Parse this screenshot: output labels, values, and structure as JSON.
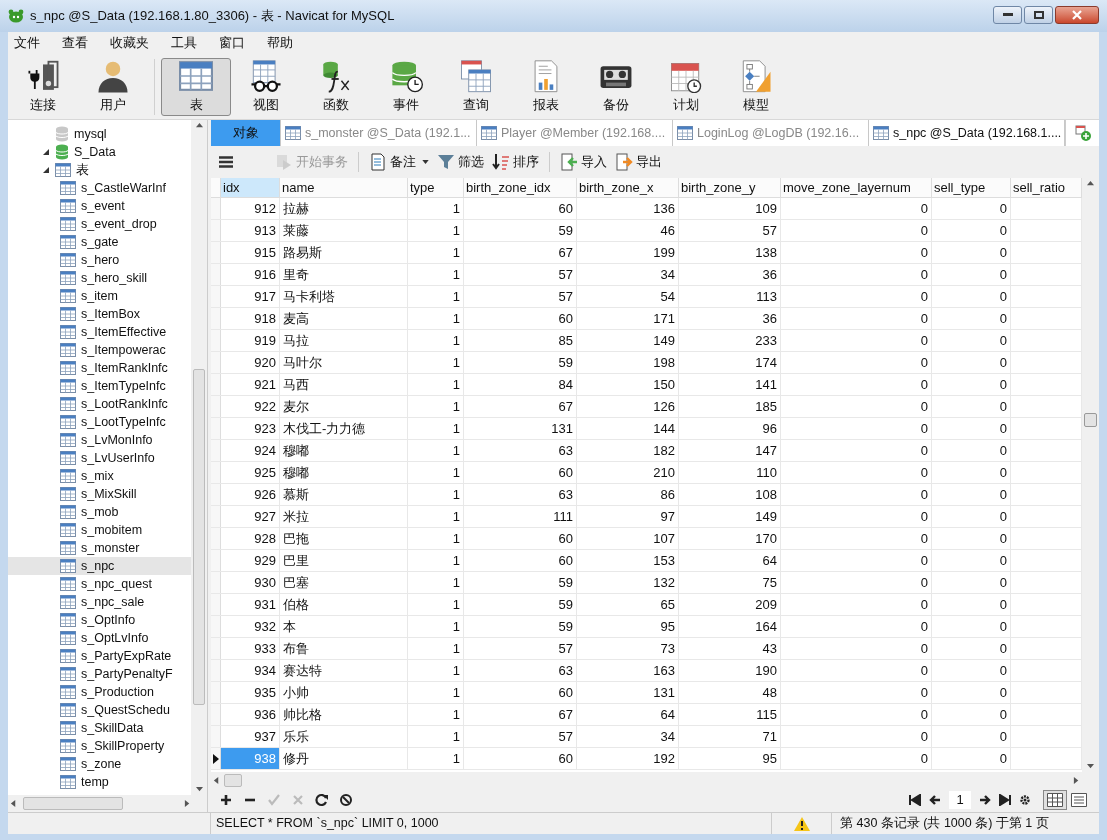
{
  "window": {
    "title": "s_npc @S_Data (192.168.1.80_3306) - 表 - Navicat for MySQL"
  },
  "menu": [
    "文件",
    "查看",
    "收藏夹",
    "工具",
    "窗口",
    "帮助"
  ],
  "toolbar": [
    {
      "label": "连接",
      "selected": false
    },
    {
      "label": "用户",
      "selected": false
    },
    {
      "label": "表",
      "selected": true
    },
    {
      "label": "视图",
      "selected": false
    },
    {
      "label": "函数",
      "selected": false
    },
    {
      "label": "事件",
      "selected": false
    },
    {
      "label": "查询",
      "selected": false
    },
    {
      "label": "报表",
      "selected": false
    },
    {
      "label": "备份",
      "selected": false
    },
    {
      "label": "计划",
      "selected": false
    },
    {
      "label": "模型",
      "selected": false
    }
  ],
  "sidebar": {
    "tree": [
      {
        "label": "mysql",
        "kind": "database",
        "expanded": false,
        "selected": false
      },
      {
        "label": "S_Data",
        "kind": "database",
        "expanded": true,
        "selected": false,
        "children": [
          {
            "label": "表",
            "kind": "folder",
            "expanded": true,
            "selected": false,
            "children": [
              {
                "label": "s_CastleWarInf",
                "kind": "table",
                "selected": false
              },
              {
                "label": "s_event",
                "kind": "table",
                "selected": false
              },
              {
                "label": "s_event_drop",
                "kind": "table",
                "selected": false
              },
              {
                "label": "s_gate",
                "kind": "table",
                "selected": false
              },
              {
                "label": "s_hero",
                "kind": "table",
                "selected": false
              },
              {
                "label": "s_hero_skill",
                "kind": "table",
                "selected": false
              },
              {
                "label": "s_item",
                "kind": "table",
                "selected": false
              },
              {
                "label": "s_ItemBox",
                "kind": "table",
                "selected": false
              },
              {
                "label": "s_ItemEffective",
                "kind": "table",
                "selected": false
              },
              {
                "label": "s_Itempowerac",
                "kind": "table",
                "selected": false
              },
              {
                "label": "s_ItemRankInfc",
                "kind": "table",
                "selected": false
              },
              {
                "label": "s_ItemTypeInfc",
                "kind": "table",
                "selected": false
              },
              {
                "label": "s_LootRankInfc",
                "kind": "table",
                "selected": false
              },
              {
                "label": "s_LootTypeInfc",
                "kind": "table",
                "selected": false
              },
              {
                "label": "s_LvMonInfo",
                "kind": "table",
                "selected": false
              },
              {
                "label": "s_LvUserInfo",
                "kind": "table",
                "selected": false
              },
              {
                "label": "s_mix",
                "kind": "table",
                "selected": false
              },
              {
                "label": "s_MixSkill",
                "kind": "table",
                "selected": false
              },
              {
                "label": "s_mob",
                "kind": "table",
                "selected": false
              },
              {
                "label": "s_mobitem",
                "kind": "table",
                "selected": false
              },
              {
                "label": "s_monster",
                "kind": "table",
                "selected": false
              },
              {
                "label": "s_npc",
                "kind": "table",
                "selected": true
              },
              {
                "label": "s_npc_quest",
                "kind": "table",
                "selected": false
              },
              {
                "label": "s_npc_sale",
                "kind": "table",
                "selected": false
              },
              {
                "label": "s_OptInfo",
                "kind": "table",
                "selected": false
              },
              {
                "label": "s_OptLvInfo",
                "kind": "table",
                "selected": false
              },
              {
                "label": "s_PartyExpRate",
                "kind": "table",
                "selected": false
              },
              {
                "label": "s_PartyPenaltyF",
                "kind": "table",
                "selected": false
              },
              {
                "label": "s_Production",
                "kind": "table",
                "selected": false
              },
              {
                "label": "s_QuestSchedu",
                "kind": "table",
                "selected": false
              },
              {
                "label": "s_SkillData",
                "kind": "table",
                "selected": false
              },
              {
                "label": "s_SkillProperty",
                "kind": "table",
                "selected": false
              },
              {
                "label": "s_zone",
                "kind": "table",
                "selected": false
              },
              {
                "label": "temp",
                "kind": "table",
                "selected": false
              }
            ]
          }
        ]
      }
    ]
  },
  "tabs": [
    {
      "label": "对象",
      "kind": "objects",
      "selected": false
    },
    {
      "label": "s_monster @S_Data (192.1...",
      "kind": "table",
      "selected": false
    },
    {
      "label": "Player @Member (192.168....",
      "kind": "table",
      "selected": false
    },
    {
      "label": "LoginLog @LogDB (192.16...",
      "kind": "table",
      "selected": false
    },
    {
      "label": "s_npc @S_Data (192.168.1....",
      "kind": "table",
      "selected": true
    }
  ],
  "grid_toolbar": [
    {
      "label": "开始事务",
      "disabled": true,
      "dropdown": false
    },
    {
      "label": "备注",
      "disabled": false,
      "dropdown": true
    },
    {
      "label": "筛选",
      "disabled": false,
      "dropdown": false
    },
    {
      "label": "排序",
      "disabled": false,
      "dropdown": false
    },
    {
      "label": "导入",
      "disabled": false,
      "dropdown": false
    },
    {
      "label": "导出",
      "disabled": false,
      "dropdown": false
    }
  ],
  "table": {
    "columns": [
      {
        "label": "idx",
        "selected": true
      },
      {
        "label": "name",
        "selected": false
      },
      {
        "label": "type",
        "selected": false
      },
      {
        "label": "birth_zone_idx",
        "selected": false
      },
      {
        "label": "birth_zone_x",
        "selected": false
      },
      {
        "label": "birth_zone_y",
        "selected": false
      },
      {
        "label": "move_zone_layernum",
        "selected": false
      },
      {
        "label": "sell_type",
        "selected": false
      },
      {
        "label": "sell_ratio",
        "selected": false
      }
    ],
    "rows": [
      {
        "selected": false,
        "cells": [
          "912",
          "拉赫",
          "1",
          "60",
          "136",
          "109",
          "0",
          "0"
        ]
      },
      {
        "selected": false,
        "cells": [
          "913",
          "莱藤",
          "1",
          "59",
          "46",
          "57",
          "0",
          "0"
        ]
      },
      {
        "selected": false,
        "cells": [
          "915",
          "路易斯",
          "1",
          "67",
          "199",
          "138",
          "0",
          "0"
        ]
      },
      {
        "selected": false,
        "cells": [
          "916",
          "里奇",
          "1",
          "57",
          "34",
          "36",
          "0",
          "0"
        ]
      },
      {
        "selected": false,
        "cells": [
          "917",
          "马卡利塔",
          "1",
          "57",
          "54",
          "113",
          "0",
          "0"
        ]
      },
      {
        "selected": false,
        "cells": [
          "918",
          "麦高",
          "1",
          "60",
          "171",
          "36",
          "0",
          "0"
        ]
      },
      {
        "selected": false,
        "cells": [
          "919",
          "马拉",
          "1",
          "85",
          "149",
          "233",
          "0",
          "0"
        ]
      },
      {
        "selected": false,
        "cells": [
          "920",
          "马叶尔",
          "1",
          "59",
          "198",
          "174",
          "0",
          "0"
        ]
      },
      {
        "selected": false,
        "cells": [
          "921",
          "马西",
          "1",
          "84",
          "150",
          "141",
          "0",
          "0"
        ]
      },
      {
        "selected": false,
        "cells": [
          "922",
          "麦尔",
          "1",
          "67",
          "126",
          "185",
          "0",
          "0"
        ]
      },
      {
        "selected": false,
        "cells": [
          "923",
          "木伐工-力力德",
          "1",
          "131",
          "144",
          "96",
          "0",
          "0"
        ]
      },
      {
        "selected": false,
        "cells": [
          "924",
          "穆嘟",
          "1",
          "63",
          "182",
          "147",
          "0",
          "0"
        ]
      },
      {
        "selected": false,
        "cells": [
          "925",
          "穆嘟",
          "1",
          "60",
          "210",
          "110",
          "0",
          "0"
        ]
      },
      {
        "selected": false,
        "cells": [
          "926",
          "慕斯",
          "1",
          "63",
          "86",
          "108",
          "0",
          "0"
        ]
      },
      {
        "selected": false,
        "cells": [
          "927",
          "米拉",
          "1",
          "111",
          "97",
          "149",
          "0",
          "0"
        ]
      },
      {
        "selected": false,
        "cells": [
          "928",
          "巴拖",
          "1",
          "60",
          "107",
          "170",
          "0",
          "0"
        ]
      },
      {
        "selected": false,
        "cells": [
          "929",
          "巴里",
          "1",
          "60",
          "153",
          "64",
          "0",
          "0"
        ]
      },
      {
        "selected": false,
        "cells": [
          "930",
          "巴塞",
          "1",
          "59",
          "132",
          "75",
          "0",
          "0"
        ]
      },
      {
        "selected": false,
        "cells": [
          "931",
          "伯格",
          "1",
          "59",
          "65",
          "209",
          "0",
          "0"
        ]
      },
      {
        "selected": false,
        "cells": [
          "932",
          "本",
          "1",
          "59",
          "95",
          "164",
          "0",
          "0"
        ]
      },
      {
        "selected": false,
        "cells": [
          "933",
          "布鲁",
          "1",
          "57",
          "73",
          "43",
          "0",
          "0"
        ]
      },
      {
        "selected": false,
        "cells": [
          "934",
          "赛达特",
          "1",
          "63",
          "163",
          "190",
          "0",
          "0"
        ]
      },
      {
        "selected": false,
        "cells": [
          "935",
          "小帅",
          "1",
          "60",
          "131",
          "48",
          "0",
          "0"
        ]
      },
      {
        "selected": false,
        "cells": [
          "936",
          "帅比格",
          "1",
          "67",
          "64",
          "115",
          "0",
          "0"
        ]
      },
      {
        "selected": false,
        "cells": [
          "937",
          "乐乐",
          "1",
          "57",
          "34",
          "71",
          "0",
          "0"
        ]
      },
      {
        "selected": true,
        "cells": [
          "938",
          "修丹",
          "1",
          "60",
          "192",
          "95",
          "0",
          "0"
        ]
      }
    ]
  },
  "record_tools": [
    {
      "kind": "add",
      "disabled": false
    },
    {
      "kind": "delete",
      "disabled": false
    },
    {
      "kind": "apply",
      "disabled": true
    },
    {
      "kind": "cancel",
      "disabled": true
    },
    {
      "kind": "refresh",
      "disabled": false
    },
    {
      "kind": "stop",
      "disabled": false
    }
  ],
  "pager": {
    "page": "1"
  },
  "view_modes": [
    {
      "kind": "grid",
      "selected": true
    },
    {
      "kind": "form",
      "selected": false
    }
  ],
  "status_bar": {
    "sql": "SELECT * FROM `s_npc` LIMIT 0, 1000",
    "warning": true,
    "record": "第 430 条记录 (共 1000 条) 于第 1 页"
  }
}
